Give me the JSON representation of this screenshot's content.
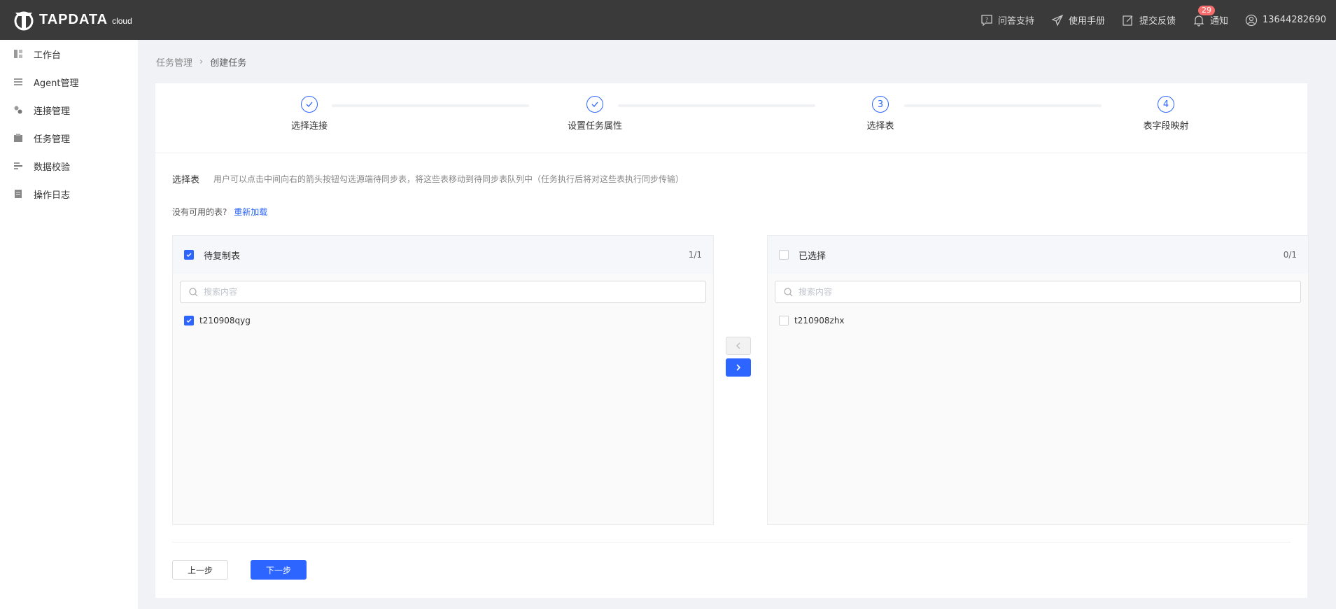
{
  "header": {
    "logo_text": "TAPDATA",
    "logo_sup": "cloud",
    "actions": [
      {
        "label": "问答支持",
        "icon": "question-icon"
      },
      {
        "label": "使用手册",
        "icon": "paper-plane-icon"
      },
      {
        "label": "提交反馈",
        "icon": "edit-icon"
      },
      {
        "label": "通知",
        "icon": "bell-icon"
      },
      {
        "label": "13644282690",
        "icon": "user-icon"
      }
    ],
    "notification_count": "29"
  },
  "sidebar": {
    "items": [
      {
        "label": "工作台",
        "icon": "dashboard-icon"
      },
      {
        "label": "Agent管理",
        "icon": "list-icon"
      },
      {
        "label": "连接管理",
        "icon": "link-icon"
      },
      {
        "label": "任务管理",
        "icon": "task-icon"
      },
      {
        "label": "数据校验",
        "icon": "check-data-icon"
      },
      {
        "label": "操作日志",
        "icon": "log-icon"
      }
    ]
  },
  "breadcrumb": {
    "parent": "任务管理",
    "current": "创建任务"
  },
  "steps": [
    {
      "label": "选择连接",
      "number": "1",
      "done": true
    },
    {
      "label": "设置任务属性",
      "number": "2",
      "done": true
    },
    {
      "label": "选择表",
      "number": "3",
      "done": false
    },
    {
      "label": "表字段映射",
      "number": "4",
      "done": false
    }
  ],
  "section": {
    "title": "选择表",
    "hint": "用户可以点击中间向右的箭头按钮勾选源端待同步表，将这些表移动到待同步表队列中（任务执行后将对这些表执行同步传输）",
    "no_table_text": "没有可用的表?",
    "reload_link": "重新加载"
  },
  "left_panel": {
    "title": "待复制表",
    "count": "1/1",
    "search_placeholder": "搜索内容",
    "items": [
      "t210908qyg"
    ]
  },
  "right_panel": {
    "title": "已选择",
    "count": "0/1",
    "search_placeholder": "搜索内容",
    "items": [
      "t210908zhx"
    ]
  },
  "footer": {
    "prev_label": "上一步",
    "next_label": "下一步"
  },
  "colors": {
    "primary": "#2c65ff",
    "header_bg": "#3a3a3a",
    "badge": "#f56c6c"
  }
}
